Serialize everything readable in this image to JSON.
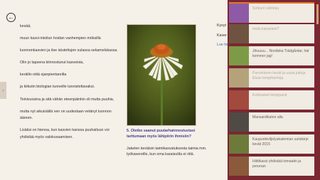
{
  "navigation": {
    "back_glyph": "←",
    "previous_glyph": "‹"
  },
  "article": {
    "column1": [
      "kesää,",
      "muun kasvi-intoilun hoidan vanhempien möksillä",
      "luonnonkasvien ja itse istutettujen sulassa sekamelskassa.",
      "Olin jo lapsena kiinnostunut kasveista,",
      "keräilin niitä ojanpientareilta",
      "ja kiikutin biologian tunneille tunnistettavaksi.",
      "Teinivuosina ja sitä vähän eteenpäinkin oli mutta puuhia,",
      "mutta nyt aikuisiällä ven on uudestaan vetänyt luonnon ääreen.",
      "Lisäksi on hienoa, kun kasvien kanssa puuhailuun voi yhdistää myös valokuvaamisen."
    ],
    "question": "5. Oletko saanut puutarhainnostustasi tarttumaan myös lähipiirin ihmisiin?",
    "answer": "Jakelen keväisin taimikasvatuksesta taimia mm. työkavereille, kun oma karaisutila ei riitä.",
    "column3": [
      {
        "text": "Kysyt",
        "link": false
      },
      {
        "text": "Kaver",
        "link": false
      },
      {
        "text": "Lue lis",
        "link": true
      }
    ]
  },
  "sidebar": {
    "cards": [
      {
        "title": "Sotkuni valintoja",
        "thumb_color": "#8e5aa6",
        "selected": true
      },
      {
        "title": "Hullu kanasieni?",
        "thumb_color": "#6e5440",
        "selected": true
      },
      {
        "title": "Jihuuuu... Nordiska Trädgårdar, här kommer jag!",
        "thumb_color": "#7d9b46",
        "selected": false
      },
      {
        "title": "Parvekkeen kevät ja uusia juttuja Elsan lempiharhoja",
        "thumb_color": "#b4a37a",
        "selected": true
      },
      {
        "title": "Kotimaiset lempipanit",
        "thumb_color": "#a24a3d",
        "selected": true
      },
      {
        "title": "Mansardikaton alla",
        "thumb_color": "#4f4a44",
        "selected": false
      },
      {
        "title": "Kaupunkiviljelyakatemian uutiskirje kevät 2015",
        "thumb_color": "#6d7a3a",
        "selected": false
      },
      {
        "title": "Hiittikassi yhdistää tomaatin ja perunan",
        "thumb_color": "#8a5a3b",
        "selected": false
      }
    ]
  }
}
